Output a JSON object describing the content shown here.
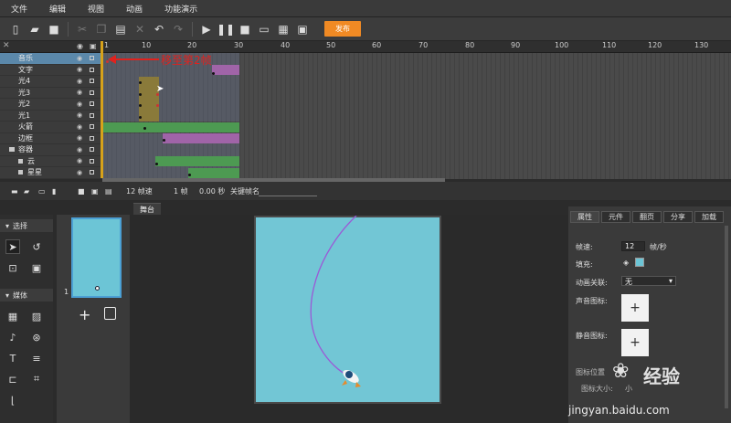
{
  "menu": [
    "文件",
    "编辑",
    "视图",
    "动画",
    "功能演示"
  ],
  "toolbar": {
    "publish_label": "发布"
  },
  "timeline": {
    "ruler_ticks": [
      "1",
      "10",
      "20",
      "30",
      "40",
      "50",
      "60",
      "70",
      "80",
      "90",
      "100",
      "110",
      "120",
      "130"
    ],
    "layers": [
      {
        "name": "音乐",
        "selected": true
      },
      {
        "name": "文字"
      },
      {
        "name": "光4"
      },
      {
        "name": "光3"
      },
      {
        "name": "光2"
      },
      {
        "name": "光1"
      },
      {
        "name": "火箭"
      },
      {
        "name": "边框"
      },
      {
        "name": "容器",
        "folder": true
      },
      {
        "name": "云"
      },
      {
        "name": "星星"
      }
    ],
    "annotation": "移至第2帧",
    "status": {
      "fps": "12 帧速",
      "frame": "1 帧",
      "time": "0.00 秒",
      "keyframe_name_label": "关键帧名"
    }
  },
  "tools": {
    "select_section": "选择",
    "media_section": "媒体"
  },
  "pages": {
    "page_number": "1"
  },
  "stage": {
    "tab_label": "舞台"
  },
  "properties": {
    "tabs": [
      "属性",
      "元件",
      "翻页",
      "分享",
      "加载"
    ],
    "fps_label": "帧速:",
    "fps_value": "12",
    "fps_unit": "帧/秒",
    "fill_label": "填充:",
    "anim_link_label": "动画关联:",
    "anim_link_value": "无",
    "sound_icon_label": "声音图标:",
    "mute_icon_label": "静音图标:",
    "icon_pos_label": "图标位置",
    "icon_size_label": "图标大小:",
    "icon_size_value": "小"
  },
  "watermark": {
    "brand": "经验",
    "url": "jingyan.baidu.com"
  },
  "colors": {
    "accent": "#f08a24",
    "stage": "#72c6d5",
    "annotation": "#e0221e",
    "selected_layer": "#5b88aa"
  }
}
